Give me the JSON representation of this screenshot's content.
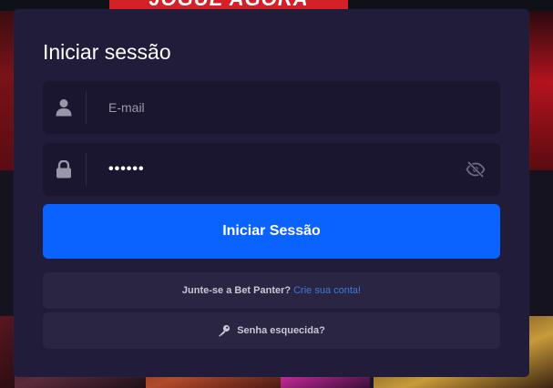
{
  "background": {
    "banner_text": "JOGUE AGORA"
  },
  "login": {
    "title": "Iniciar sessão",
    "email": {
      "placeholder": "E-mail",
      "value": "",
      "icon": "user-icon"
    },
    "password": {
      "value": "••••••",
      "icon": "lock-icon",
      "toggle_icon": "eye-slash-icon"
    },
    "submit_label": "Iniciar Sessão",
    "join": {
      "text": "Junte-se a Bet Panter?",
      "link": "Crie sua conta!"
    },
    "forgot": {
      "icon": "key-icon",
      "label": "Senha esquecida?"
    }
  },
  "colors": {
    "modal_bg": "#211c39",
    "field_bg": "#1a1630",
    "primary": "#0a63fe",
    "link": "#3d7ad8"
  }
}
